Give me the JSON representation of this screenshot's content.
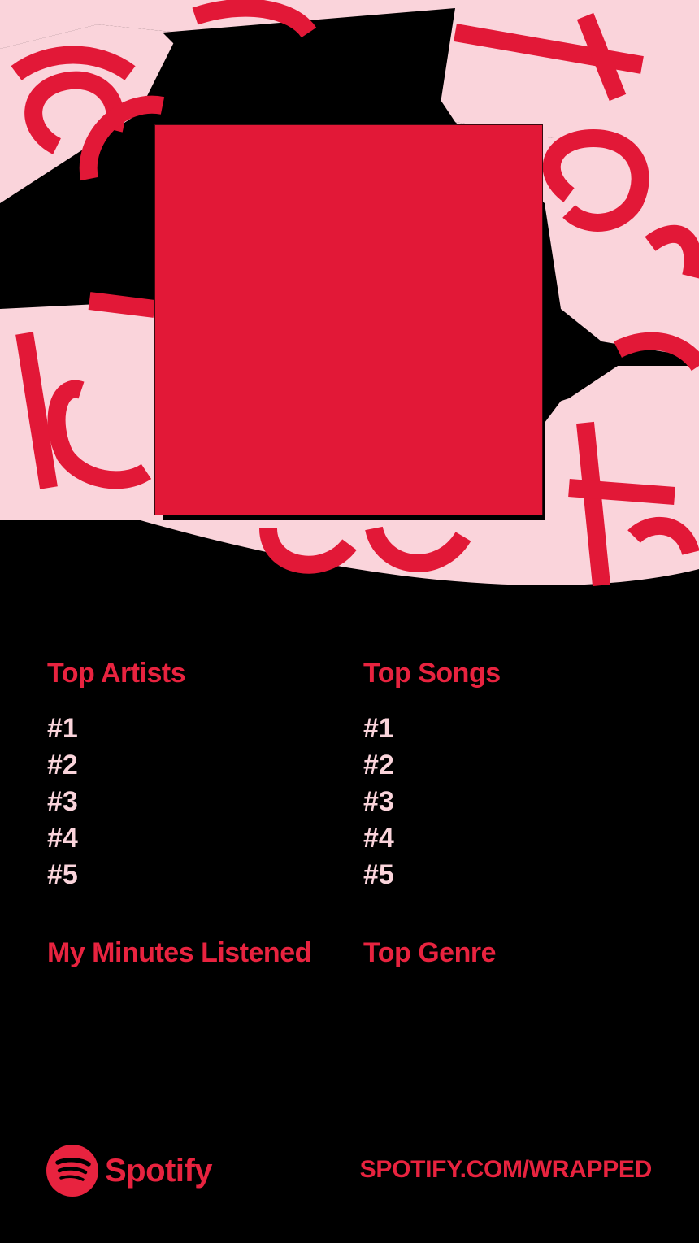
{
  "colors": {
    "background": "#000000",
    "accent_red": "#E8233F",
    "cover_red": "#E21837",
    "pink": "#FAD4DB",
    "glyph_red": "#E21837"
  },
  "cover_art": {
    "placeholder": ""
  },
  "top_artists": {
    "title": "Top Artists",
    "ranks": [
      "#1",
      "#2",
      "#3",
      "#4",
      "#5"
    ]
  },
  "top_songs": {
    "title": "Top Songs",
    "ranks": [
      "#1",
      "#2",
      "#3",
      "#4",
      "#5"
    ]
  },
  "minutes": {
    "title": "My Minutes Listened"
  },
  "genre": {
    "title": "Top Genre"
  },
  "footer": {
    "brand": "Spotify",
    "brand_icon": "spotify-logo-icon",
    "url": "SPOTIFY.COM/WRAPPED"
  }
}
